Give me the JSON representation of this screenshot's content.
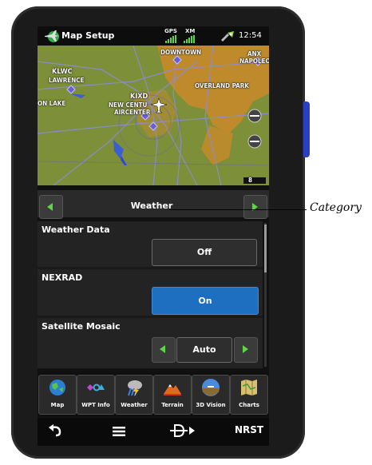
{
  "status_bar": {
    "title": "Map Setup",
    "gps_label": "GPS",
    "xm_label": "XM",
    "clock": "12:54",
    "icons": [
      "aircraft-map-icon",
      "signal-bars-icon",
      "gps-satellite-icon"
    ]
  },
  "map": {
    "labels": {
      "downtown": "DOWNTOWN",
      "anx": "ANX",
      "napoleo": "NAPOLEO",
      "klwc": "KLWC",
      "lawrence": "LAWRENCE",
      "overland_park": "OVERLAND PARK",
      "kixd": "KIXD",
      "new_centu": "NEW CENTU",
      "aircenter": "AIRCENTER",
      "on_lake": "ON LAKE"
    },
    "scale": "8",
    "zoom_out_icon": "zoom-out-icon",
    "zoom_in_icon": "zoom-in-icon"
  },
  "category_bar": {
    "label": "Weather",
    "prev_icon": "left-arrow-icon",
    "next_icon": "right-arrow-icon"
  },
  "settings": [
    {
      "label": "Weather Data",
      "value": "Off"
    },
    {
      "label": "NEXRAD",
      "value": "On"
    },
    {
      "label": "Satellite Mosaic",
      "value": "Auto"
    }
  ],
  "tabs": [
    {
      "label": "Map",
      "icon": "globe-icon"
    },
    {
      "label": "WPT Info",
      "icon": "waypoint-info-icon"
    },
    {
      "label": "Weather",
      "icon": "weather-icon"
    },
    {
      "label": "Terrain",
      "icon": "terrain-icon"
    },
    {
      "label": "3D Vision",
      "icon": "3d-vision-icon"
    },
    {
      "label": "Charts",
      "icon": "charts-icon"
    }
  ],
  "system_keys": {
    "back_icon": "back-icon",
    "menu_icon": "menu-icon",
    "direct_to_icon": "direct-to-icon",
    "nrst": "NRST"
  },
  "callout": "Category",
  "colors": {
    "accent_on": "#1f6fc0",
    "map_terrain": "#7d8f38",
    "map_urban": "#c98a2a",
    "water": "#3a5fd0"
  }
}
